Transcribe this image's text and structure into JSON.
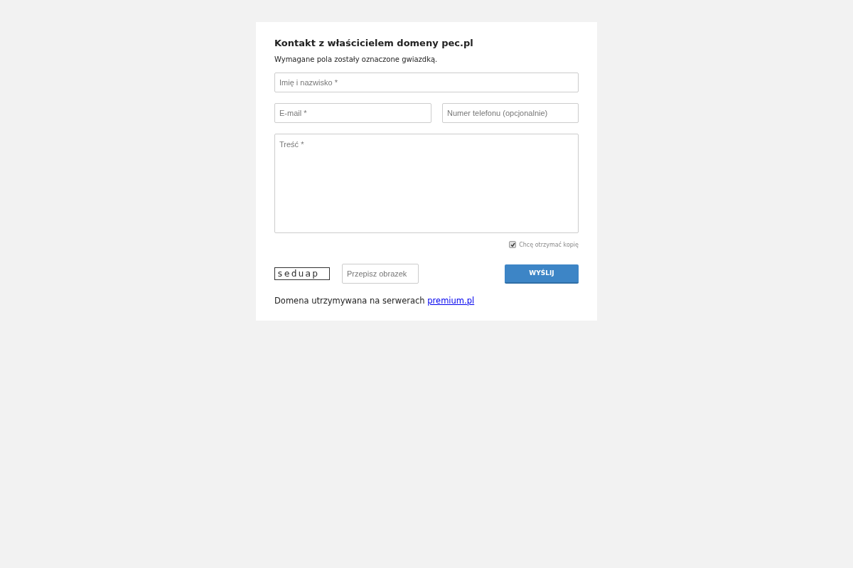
{
  "title": "Kontakt z właścicielem domeny pec.pl",
  "note": "Wymagane pola zostały oznaczone gwiazdką.",
  "fields": {
    "name": {
      "placeholder": "Imię i nazwisko *"
    },
    "email": {
      "placeholder": "E-mail *"
    },
    "phone": {
      "placeholder": "Numer telefonu (opcjonalnie)"
    },
    "message": {
      "placeholder": "Treść *"
    }
  },
  "copy_checkbox": {
    "label": "Chcę otrzymać kopię",
    "checked": true
  },
  "captcha": {
    "text": "seduap"
  },
  "captcha_field": {
    "placeholder": "Przepisz obrazek"
  },
  "submit_button": "WYŚLIJ",
  "footer": {
    "text": "Domena utrzymywana na serwerach",
    "link": "premium.pl"
  }
}
